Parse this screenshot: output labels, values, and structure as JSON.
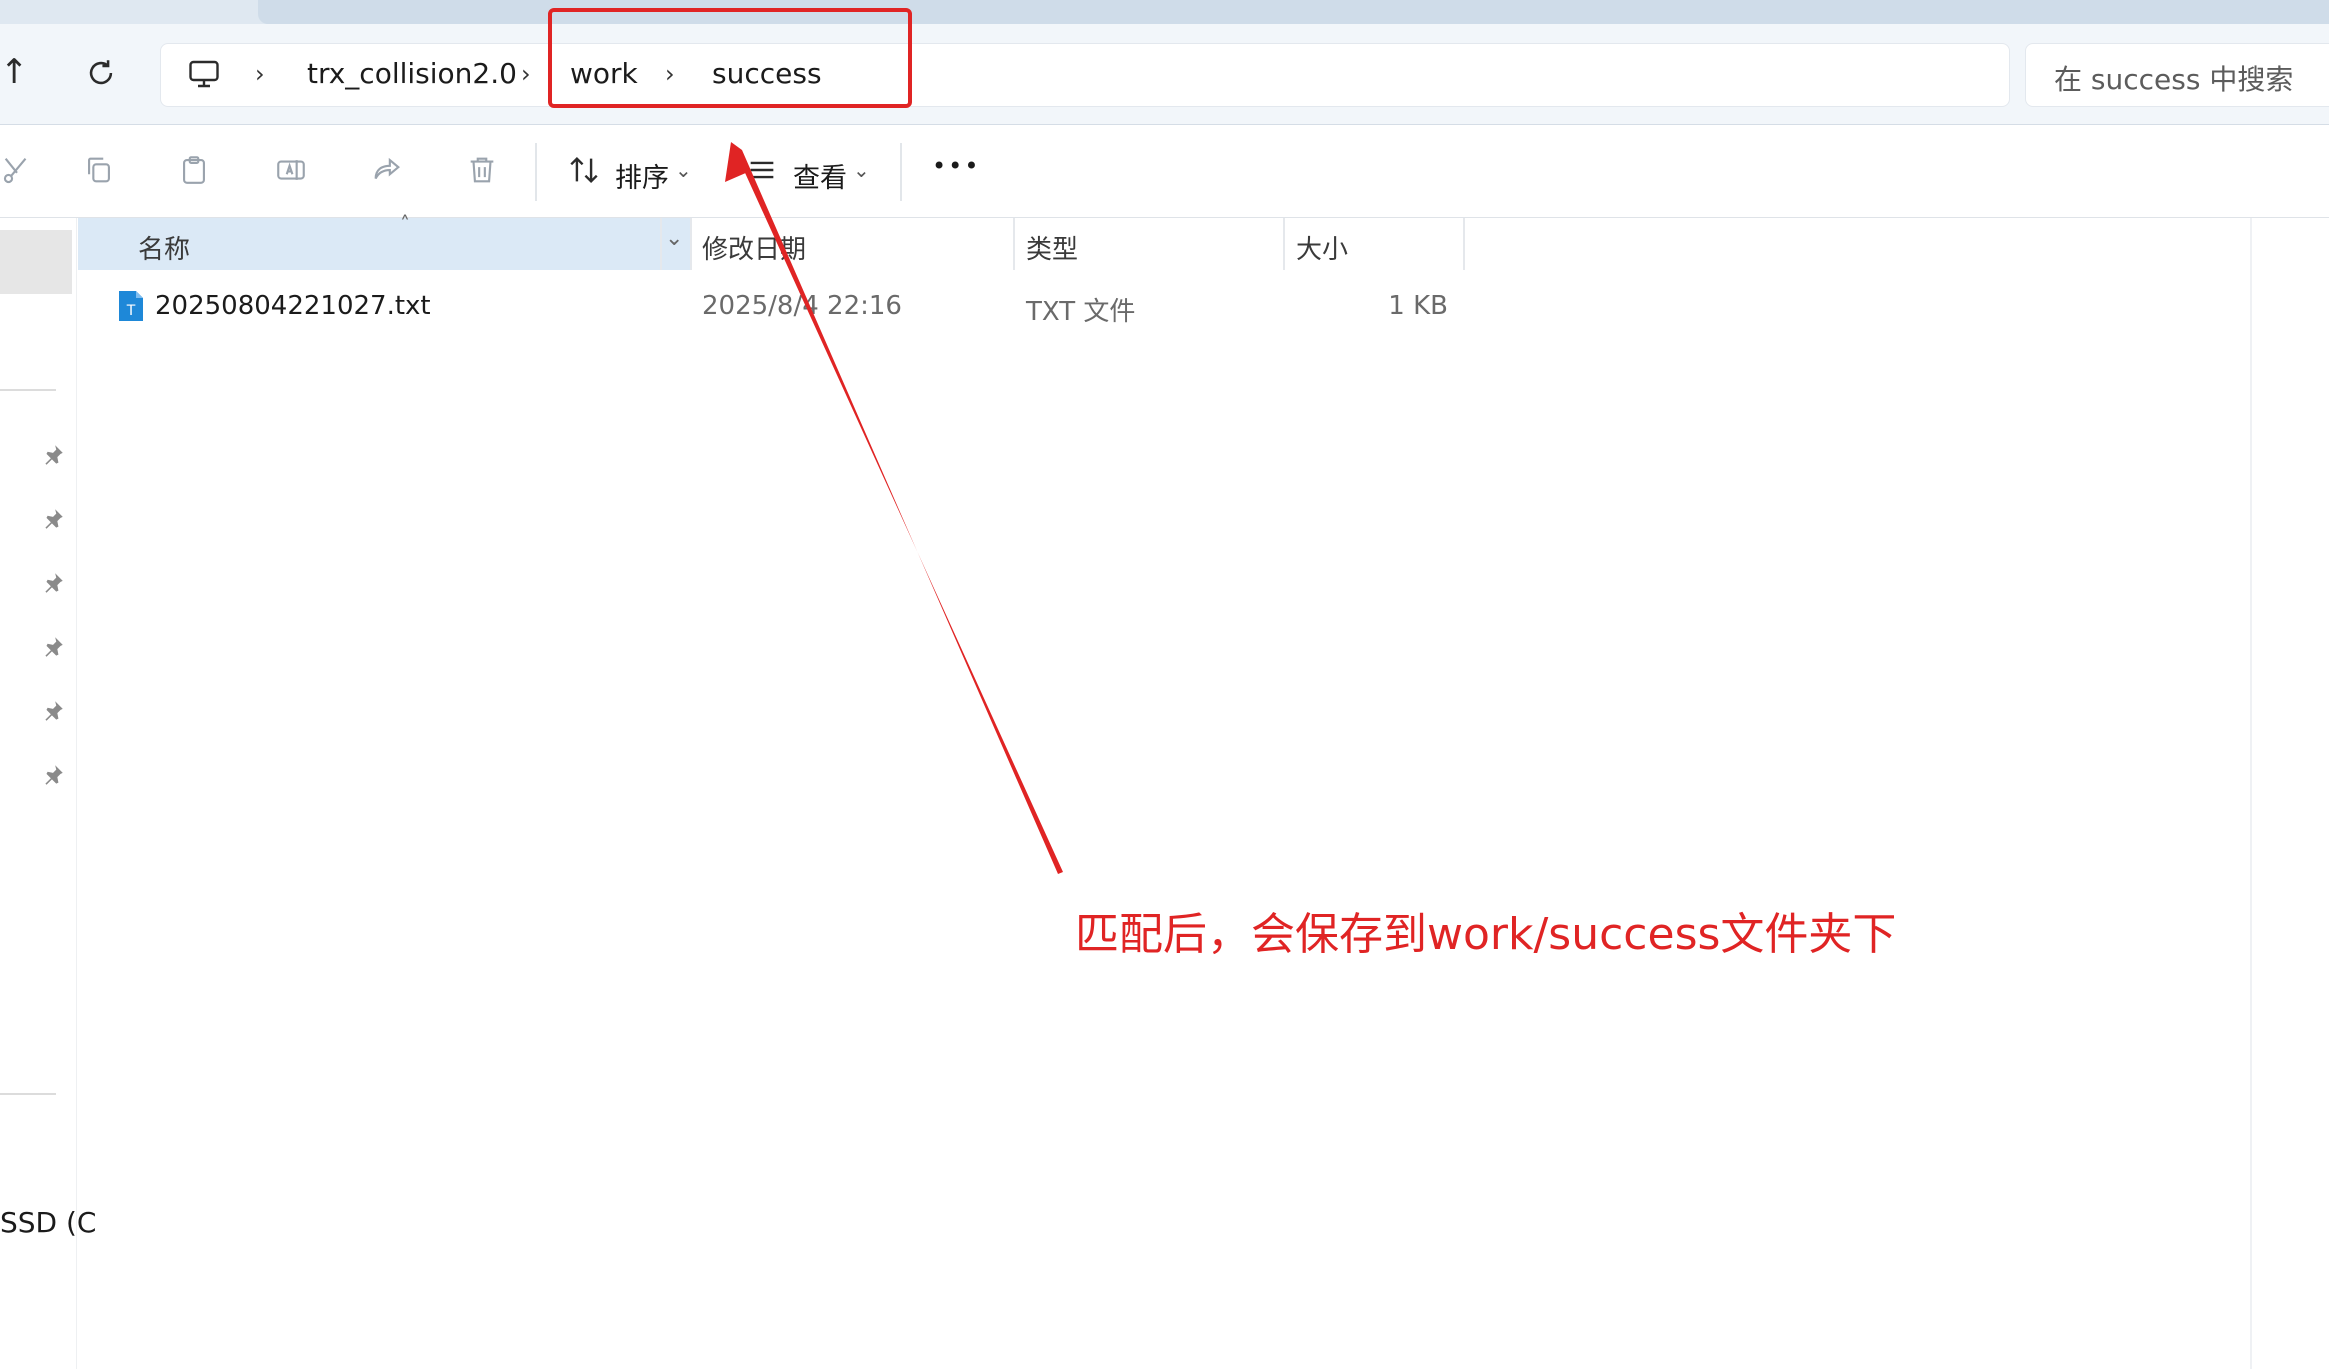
{
  "address_bar": {
    "breadcrumbs": [
      "trx_collision2.0",
      "work",
      "success"
    ],
    "search_placeholder": "在 success 中搜索"
  },
  "toolbar": {
    "sort_label": "排序",
    "view_label": "查看",
    "more_label": "•••"
  },
  "sidebar": {
    "drive_label": "SSD (C"
  },
  "file_list": {
    "columns": [
      "名称",
      "修改日期",
      "类型",
      "大小"
    ],
    "rows": [
      {
        "name": "20250804221027.txt",
        "modified": "2025/8/4 22:16",
        "type": "TXT 文件",
        "size": "1 KB",
        "icon_letter": "T"
      }
    ]
  },
  "annotation": {
    "text": "匹配后，会保存到work/success文件夹下",
    "color": "#e02424"
  },
  "colors": {
    "selected_header": "#dbe9f6",
    "txt_icon": "#1e88d8"
  }
}
